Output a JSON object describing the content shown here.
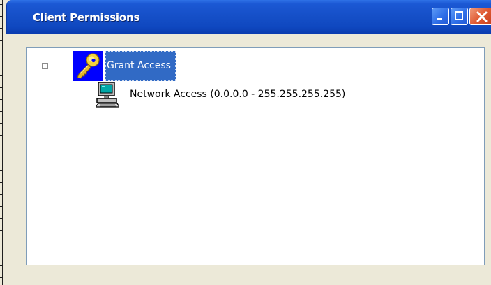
{
  "window": {
    "title": "Client Permissions"
  },
  "title_buttons": {
    "minimize_icon": "minimize-icon",
    "maximize_icon": "maximize-icon",
    "close_icon": "close-icon"
  },
  "tree": {
    "root": {
      "label": "Grant Access",
      "icon": "key-icon",
      "expanded": true,
      "selected": true
    },
    "children": [
      {
        "label": "Network Access (0.0.0.0 - 255.255.255.255)",
        "icon": "computer-icon"
      }
    ]
  },
  "colors": {
    "titlebar": "#1650c8",
    "selection": "#316ac5",
    "window_bg": "#ece9d8",
    "key_icon_bg": "#0000ff"
  }
}
